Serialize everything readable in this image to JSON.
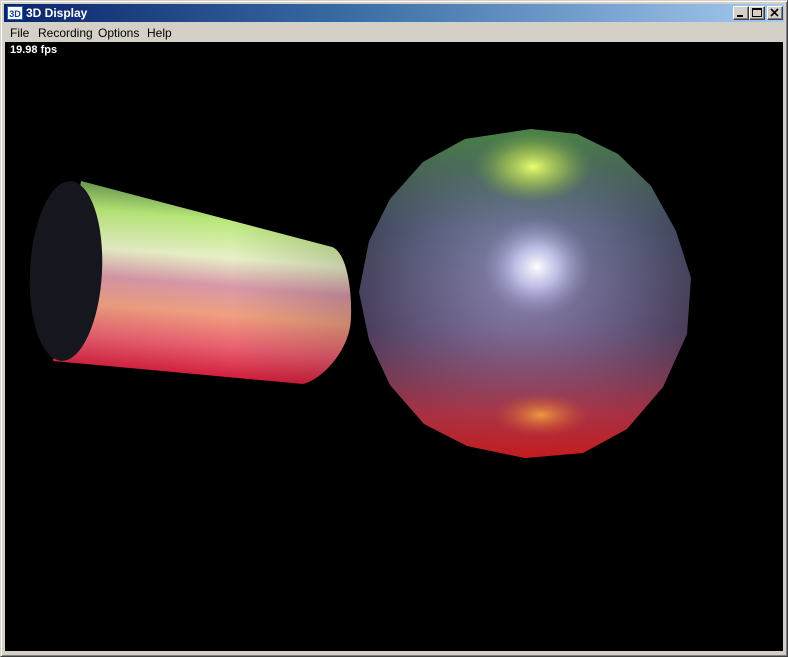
{
  "window": {
    "title": "3D Display",
    "app_icon": "3d-app-icon",
    "controls": [
      "minimize-icon",
      "maximize-icon",
      "close-icon"
    ]
  },
  "menu": {
    "items": [
      "File",
      "Recording",
      "Options",
      "Help"
    ]
  },
  "viewport": {
    "fps_text": "19.98 fps",
    "background": "#000000",
    "objects": [
      {
        "type": "cylinder",
        "colors": [
          "#b8e878",
          "#d898a8",
          "#e83048"
        ]
      },
      {
        "type": "sphere",
        "colors": [
          "#d8ff60",
          "#e8e8ff",
          "#c81818"
        ]
      }
    ]
  },
  "colors": {
    "titlebar_start": "#0a246a",
    "titlebar_end": "#a6caf0",
    "chrome": "#d4d0c8"
  }
}
